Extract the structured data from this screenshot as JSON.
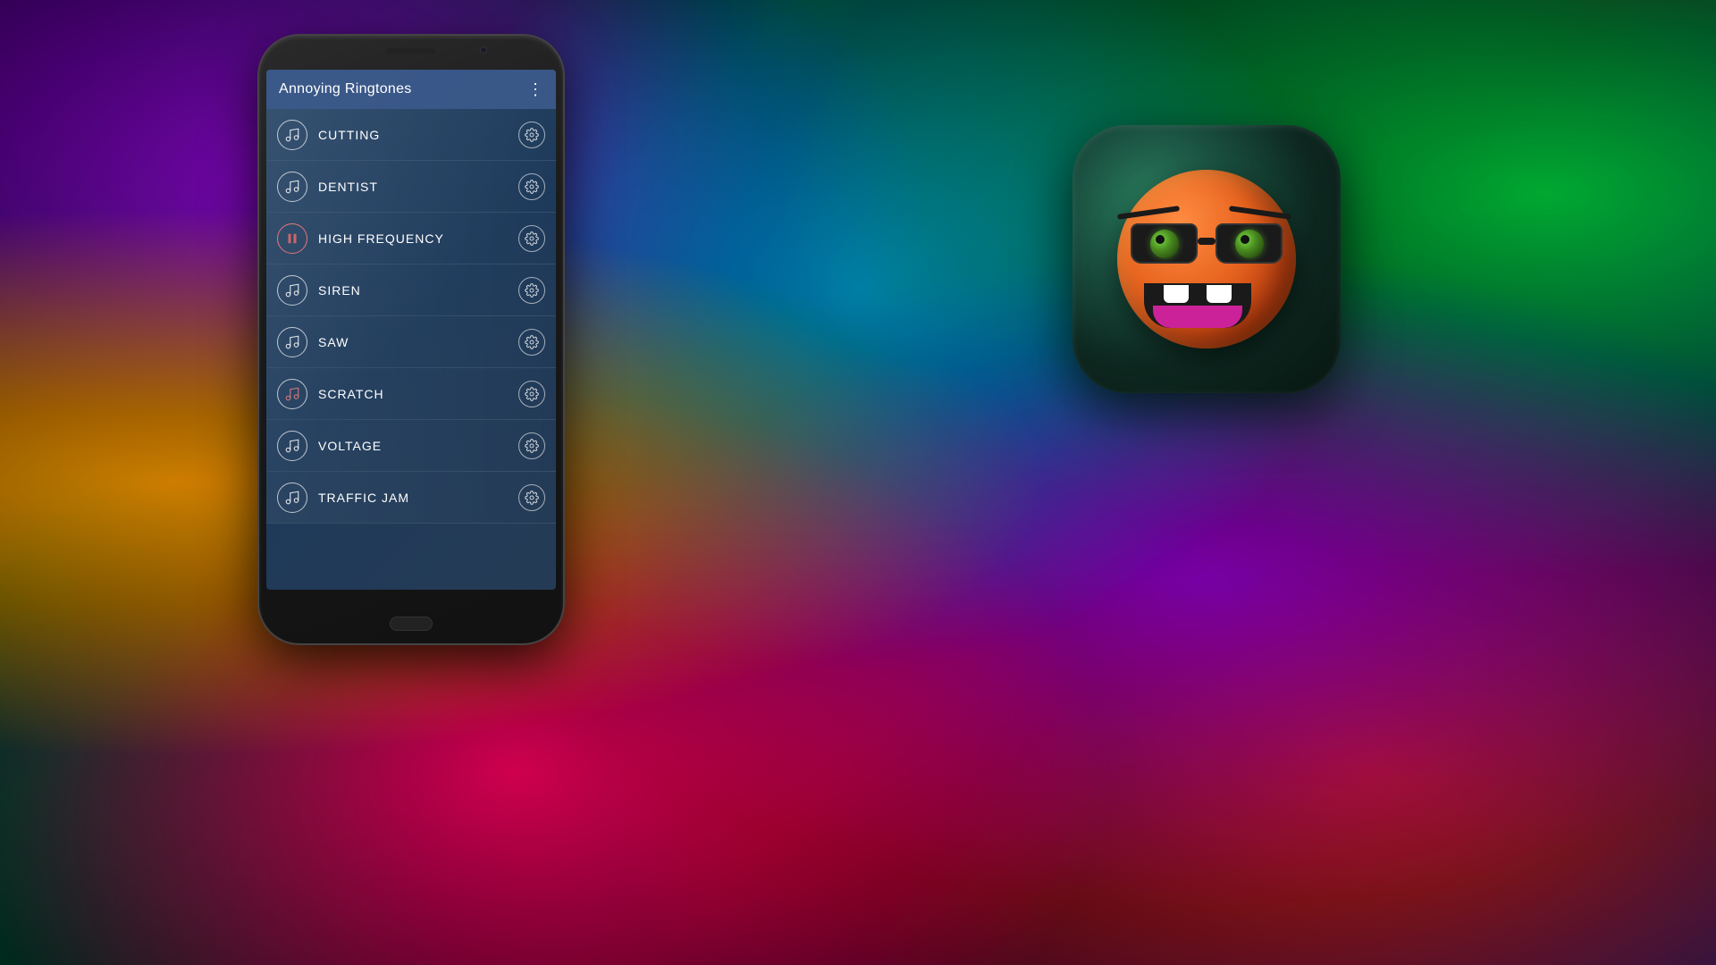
{
  "app": {
    "title": "Annoying Ringtones",
    "menu_dots": "⋮"
  },
  "ringtones": [
    {
      "id": 1,
      "name": "CUTTING",
      "icon": "music",
      "playing": false
    },
    {
      "id": 2,
      "name": "DENTIST",
      "icon": "music",
      "playing": false
    },
    {
      "id": 3,
      "name": "HIGH FREQUENCY",
      "icon": "pause",
      "playing": true
    },
    {
      "id": 4,
      "name": "SIREN",
      "icon": "music",
      "playing": false
    },
    {
      "id": 5,
      "name": "SAW",
      "icon": "music",
      "playing": false
    },
    {
      "id": 6,
      "name": "SCRATCH",
      "icon": "music",
      "playing": false
    },
    {
      "id": 7,
      "name": "VOLTAGE",
      "icon": "music",
      "playing": false
    },
    {
      "id": 8,
      "name": "TRAFFIC JAM",
      "icon": "music",
      "playing": false
    }
  ],
  "colors": {
    "accent": "#5b7fc0",
    "bg_dark": "#1e3a5a",
    "text_white": "#ffffff"
  }
}
